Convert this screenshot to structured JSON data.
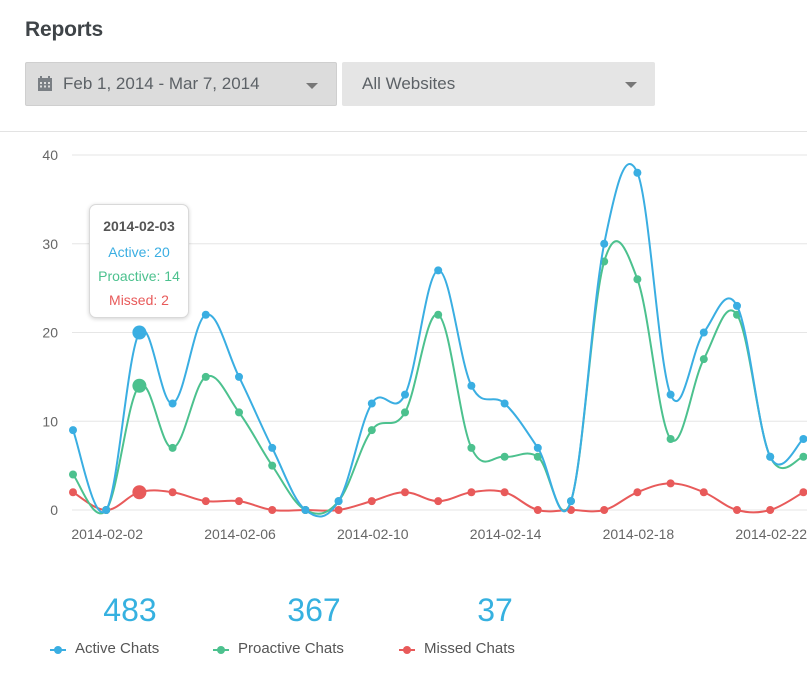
{
  "page": {
    "title": "Reports"
  },
  "filters": {
    "date_range": "Feb 1, 2014 - Mar 7, 2014",
    "website": "All Websites"
  },
  "colors": {
    "active": "#3aaee2",
    "proactive": "#4cc18e",
    "missed": "#e85a5a",
    "grid": "#e6e6e6"
  },
  "tooltip": {
    "date": "2014-02-03",
    "active": "Active: 20",
    "proactive": "Proactive: 14",
    "missed": "Missed: 2"
  },
  "stats": [
    {
      "value": "483",
      "label": "Active Chats"
    },
    {
      "value": "367",
      "label": "Proactive Chats"
    },
    {
      "value": "37",
      "label": "Missed Chats"
    }
  ],
  "chart_data": {
    "type": "line",
    "ylim": [
      0,
      40
    ],
    "yticks": [
      "0",
      "10",
      "20",
      "30",
      "40"
    ],
    "x": [
      "2014-02-01",
      "2014-02-02",
      "2014-02-03",
      "2014-02-04",
      "2014-02-05",
      "2014-02-06",
      "2014-02-07",
      "2014-02-08",
      "2014-02-09",
      "2014-02-10",
      "2014-02-11",
      "2014-02-12",
      "2014-02-13",
      "2014-02-14",
      "2014-02-15",
      "2014-02-16",
      "2014-02-17",
      "2014-02-18",
      "2014-02-19",
      "2014-02-20",
      "2014-02-21",
      "2014-02-22",
      "2014-02-23"
    ],
    "xtick_labels": [
      "2014-02-02",
      "2014-02-06",
      "2014-02-10",
      "2014-02-14",
      "2014-02-18",
      "2014-02-22"
    ],
    "highlight_index": 2,
    "series": [
      {
        "name": "Active Chats",
        "color": "#3aaee2",
        "values": [
          9,
          0,
          20,
          12,
          22,
          15,
          7,
          0,
          1,
          12,
          13,
          27,
          14,
          12,
          7,
          1,
          30,
          38,
          13,
          20,
          23,
          6,
          8
        ]
      },
      {
        "name": "Proactive Chats",
        "color": "#4cc18e",
        "values": [
          4,
          0,
          14,
          7,
          15,
          11,
          5,
          0,
          1,
          9,
          11,
          22,
          7,
          6,
          6,
          1,
          28,
          26,
          8,
          17,
          22,
          6,
          6
        ]
      },
      {
        "name": "Missed Chats",
        "color": "#e85a5a",
        "values": [
          2,
          0,
          2,
          2,
          1,
          1,
          0,
          0,
          0,
          1,
          2,
          1,
          2,
          2,
          0,
          0,
          0,
          2,
          3,
          2,
          0,
          0,
          2
        ]
      }
    ]
  }
}
